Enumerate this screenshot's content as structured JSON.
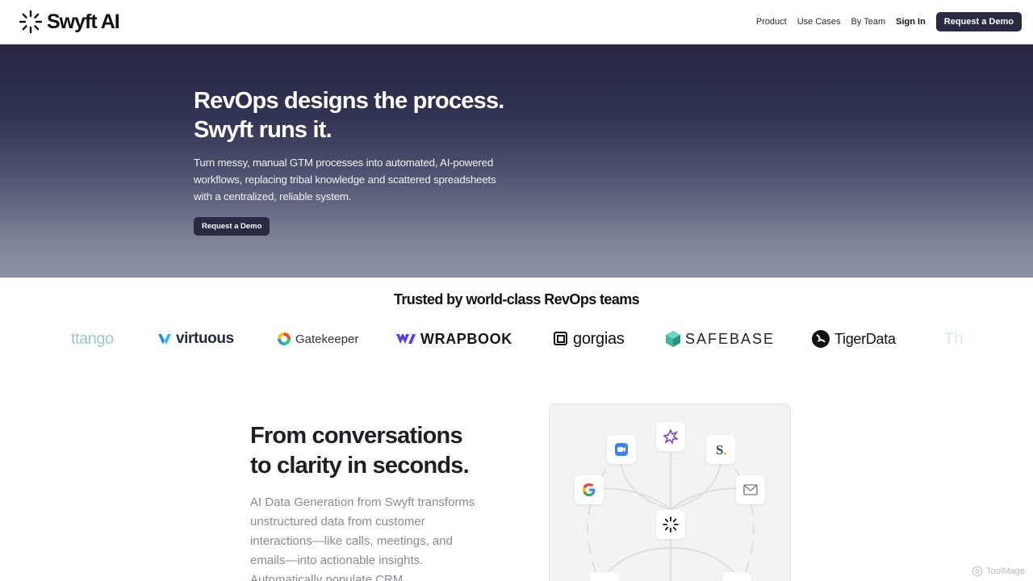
{
  "header": {
    "brand": "Swyft AI",
    "nav": {
      "product": "Product",
      "use_cases": "Use Cases",
      "by_team": "By Team",
      "sign_in": "Sign In",
      "request_demo": "Request a Demo"
    }
  },
  "hero": {
    "title_line1": "RevOps designs the process.",
    "title_line2": "Swyft runs it.",
    "subtitle": "Turn messy, manual GTM processes into automated, AI-powered workflows, replacing tribal knowledge and scattered spreadsheets with a centralized, reliable system.",
    "cta": "Request a Demo"
  },
  "trusted": {
    "title": "Trusted by world-class RevOps teams",
    "logos": [
      "ttango",
      "virtuous",
      "Gatekeeper",
      "WRAPBOOK",
      "gorgias",
      "SAFEBASE",
      "TigerData",
      "Th"
    ]
  },
  "feature": {
    "title_line1": "From conversations",
    "title_line2": "to clarity in seconds.",
    "body": "AI Data Generation from Swyft transforms unstructured data from customer interactions—like calls, meetings, and emails—into actionable insights. Automatically populate CRM",
    "diagram_icons": [
      "zoom-icon",
      "sparkle-icon",
      "s-icon",
      "google-icon",
      "mail-icon",
      "swyft-icon"
    ]
  },
  "watermark": "ToolMage",
  "colors": {
    "primary_dark": "#2a2b43",
    "hero_top": "#262844",
    "hero_bottom": "#8d91a4",
    "text_muted": "#8a8a92"
  }
}
